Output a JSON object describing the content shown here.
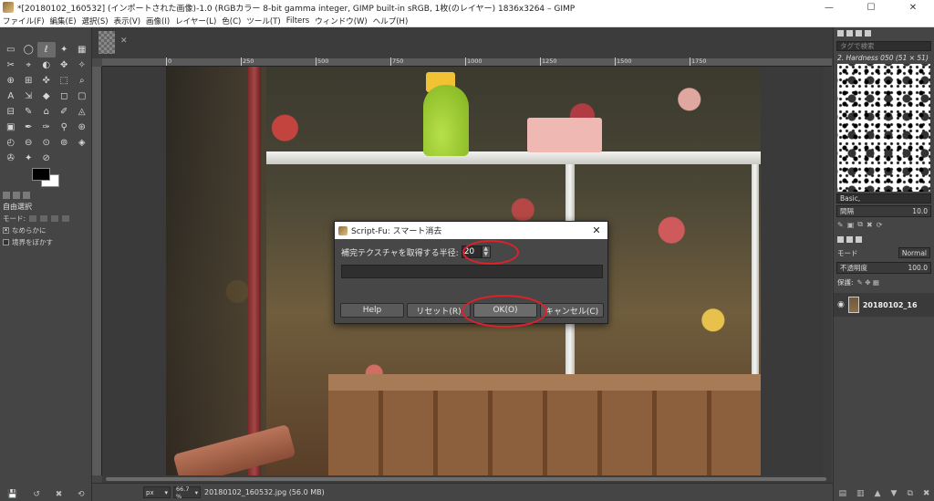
{
  "window": {
    "title": "*[20180102_160532] (インポートされた画像)-1.0 (RGBカラー 8-bit gamma integer, GIMP built-in sRGB, 1枚(のレイヤー) 1836x3264 – GIMP",
    "minimize": "—",
    "maximize": "☐",
    "close": "✕"
  },
  "menu": [
    "ファイル(F)",
    "編集(E)",
    "選択(S)",
    "表示(V)",
    "画像(I)",
    "レイヤー(L)",
    "色(C)",
    "ツール(T)",
    "Filters",
    "ウィンドウ(W)",
    "ヘルプ(H)"
  ],
  "toolbox": {
    "tools": [
      "▭",
      "◯",
      "ℓ",
      "✦",
      "▦",
      "✂",
      "⌖",
      "◐",
      "✥",
      "✧",
      "⊕",
      "⊞",
      "✜",
      "⬚",
      "⌕",
      "A",
      "⇲",
      "◆",
      "◻",
      "▢",
      "⊟",
      "✎",
      "⌂",
      "✐",
      "◬",
      "▣",
      "✒",
      "✑",
      "⚲",
      "⊛",
      "◴",
      "⊖",
      "⊙",
      "⊚",
      "◈",
      "✇",
      "✦",
      "⊘"
    ],
    "options_title": "自由選択",
    "mode_label": "モード:",
    "antialias_label": "なめらかに",
    "feather_label": "境界をぼかす",
    "check_mark": "✕"
  },
  "image_tab": {
    "close": "✕"
  },
  "ruler": {
    "ticks": [
      "0",
      "250",
      "500",
      "750",
      "1000",
      "1250",
      "1500",
      "1750"
    ]
  },
  "dialog": {
    "title": "Script-Fu: スマート消去",
    "close": "✕",
    "radius_label": "補完テクスチャを取得する半径:",
    "radius_value": "20",
    "spinner_up": "▲",
    "spinner_down": "▼",
    "buttons": {
      "help": "Help",
      "reset": "リセット(R)",
      "ok": "OK(O)",
      "cancel": "キャンセル(C)"
    }
  },
  "status": {
    "unit": "px",
    "zoom": "66.7 %",
    "dropdown": "▾",
    "text": "20180102_160532.jpg (56.0 MB)"
  },
  "rightdock": {
    "tag_placeholder": "タグで検索",
    "brush_name": "2. Hardness 050 (51 × 51)",
    "preset": "Basic,",
    "spacing_label": "間隔",
    "spacing_value": "10.0",
    "mode_label": "モード",
    "mode_value": "Normal",
    "opacity_label": "不透明度",
    "opacity_value": "100.0",
    "lock_label": "保護:",
    "layer_name": "20180102_16",
    "eye": "◉"
  },
  "colors": {
    "annotation": "#e0202a",
    "foreground": "#000000",
    "background": "#ffffff"
  }
}
